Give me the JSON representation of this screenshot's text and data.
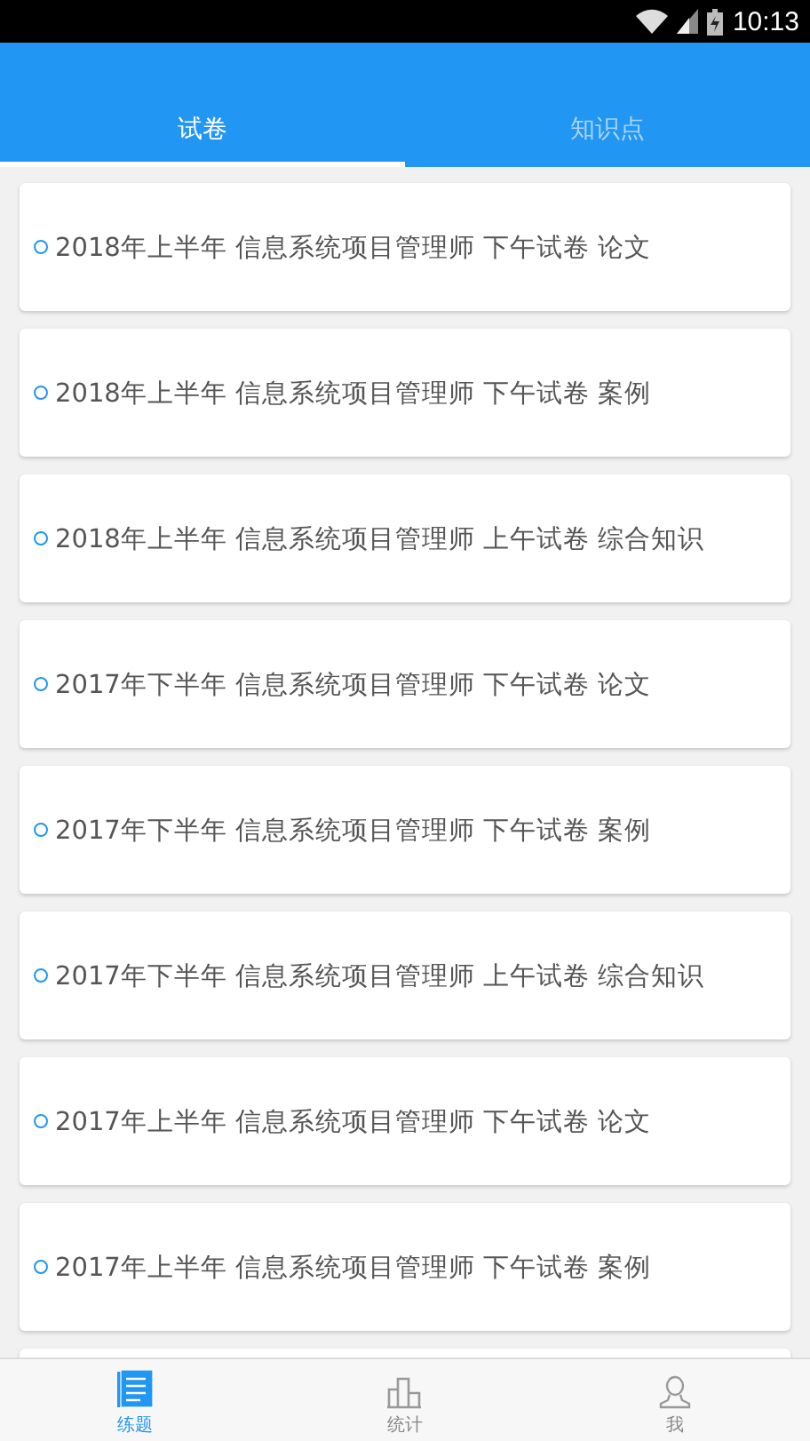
{
  "status_bar": {
    "time": "10:13"
  },
  "tabs": [
    {
      "label": "试卷",
      "selected": true
    },
    {
      "label": "知识点",
      "selected": false
    }
  ],
  "papers": [
    {
      "title": "2018年上半年 信息系统项目管理师 下午试卷 论文"
    },
    {
      "title": "2018年上半年 信息系统项目管理师 下午试卷 案例"
    },
    {
      "title": "2018年上半年 信息系统项目管理师 上午试卷 综合知识"
    },
    {
      "title": "2017年下半年 信息系统项目管理师 下午试卷 论文"
    },
    {
      "title": "2017年下半年 信息系统项目管理师 下午试卷 案例"
    },
    {
      "title": "2017年下半年 信息系统项目管理师 上午试卷 综合知识"
    },
    {
      "title": "2017年上半年 信息系统项目管理师 下午试卷 论文"
    },
    {
      "title": "2017年上半年 信息系统项目管理师 下午试卷 案例"
    }
  ],
  "bottom_nav": [
    {
      "label": "练题",
      "kind": "practice",
      "selected": true
    },
    {
      "label": "统计",
      "kind": "stats",
      "selected": false
    },
    {
      "label": "我",
      "kind": "me",
      "selected": false
    }
  ]
}
